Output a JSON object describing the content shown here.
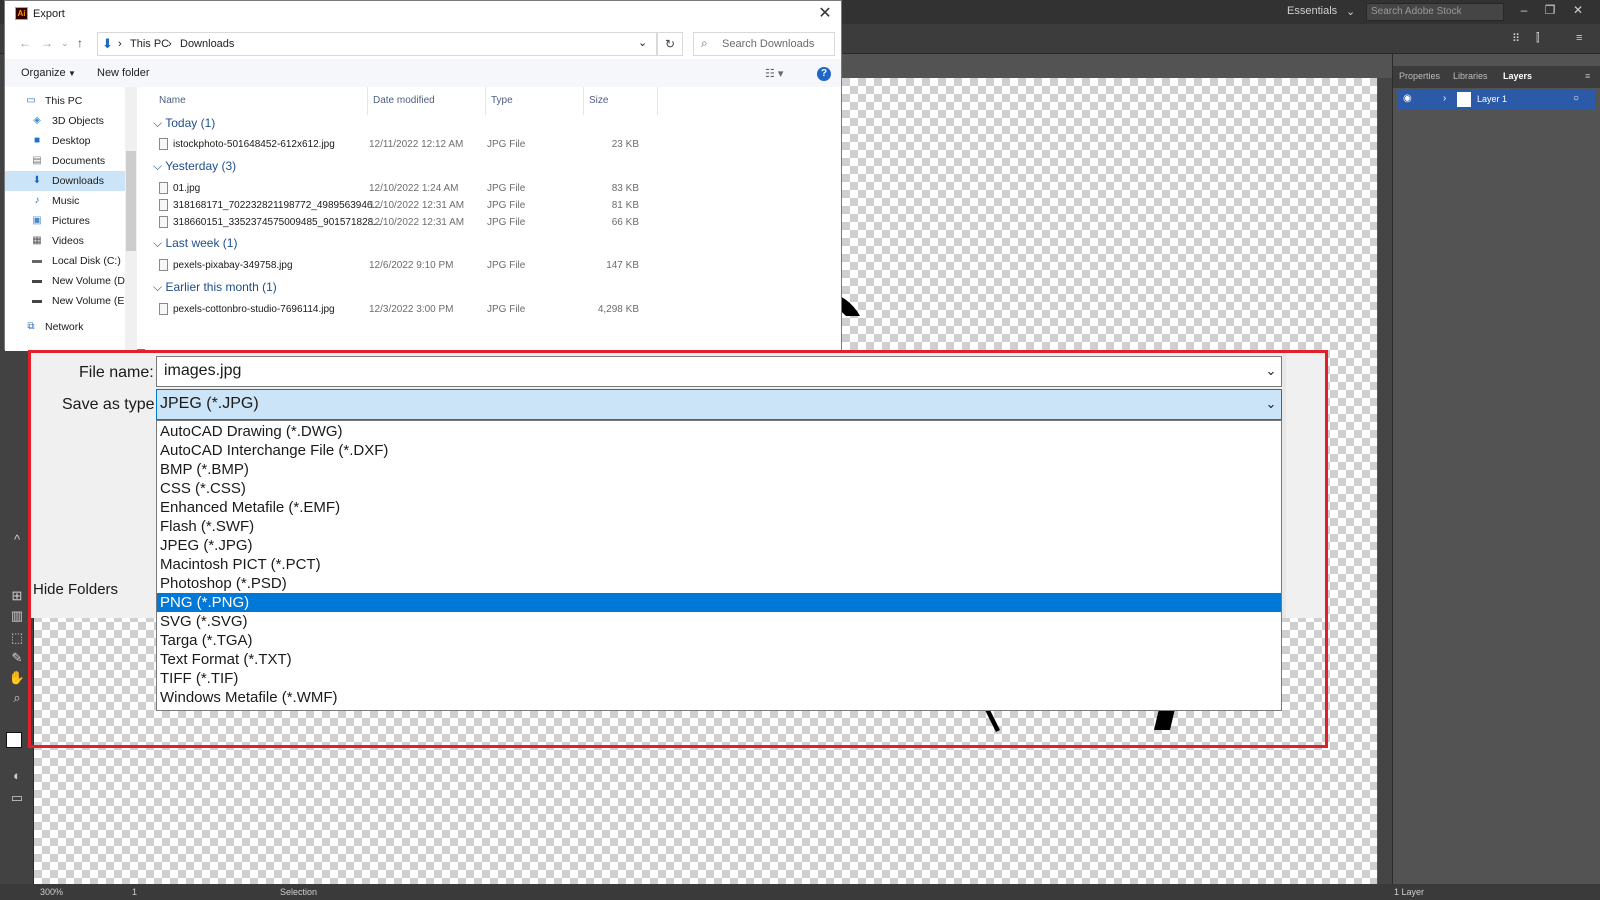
{
  "illustrator": {
    "workspace": "Essentials",
    "stock_search_placeholder": "Search Adobe Stock",
    "panel_tabs": [
      "Properties",
      "Libraries",
      "Layers"
    ],
    "active_tab": "Layers",
    "layer_name": "Layer 1",
    "status": {
      "zoom": "300%",
      "artboard": "1",
      "tool": "Selection",
      "layers_count": "1 Layer"
    }
  },
  "dialog": {
    "title": "Export",
    "logo": "Ai",
    "breadcrumb": [
      "This PC",
      "Downloads"
    ],
    "search_placeholder": "Search Downloads",
    "organize_label": "Organize",
    "new_folder_label": "New folder",
    "nav_items": [
      {
        "label": "This PC",
        "icon": "computer-icon"
      },
      {
        "label": "3D Objects",
        "icon": "cube-icon"
      },
      {
        "label": "Desktop",
        "icon": "desktop-icon"
      },
      {
        "label": "Documents",
        "icon": "document-icon"
      },
      {
        "label": "Downloads",
        "icon": "download-icon"
      },
      {
        "label": "Music",
        "icon": "music-icon"
      },
      {
        "label": "Pictures",
        "icon": "picture-icon"
      },
      {
        "label": "Videos",
        "icon": "video-icon"
      },
      {
        "label": "Local Disk (C:)",
        "icon": "disk-icon"
      },
      {
        "label": "New Volume (D:",
        "icon": "drive-icon"
      },
      {
        "label": "New Volume (E:)",
        "icon": "drive-icon"
      },
      {
        "label": "Network",
        "icon": "network-icon"
      }
    ],
    "columns": {
      "name": "Name",
      "date": "Date modified",
      "type": "Type",
      "size": "Size"
    },
    "groups": [
      {
        "label": "Today (1)",
        "files": [
          {
            "name": "istockphoto-501648452-612x612.jpg",
            "date": "12/11/2022 12:12 AM",
            "type": "JPG File",
            "size": "23 KB"
          }
        ]
      },
      {
        "label": "Yesterday (3)",
        "files": [
          {
            "name": "01.jpg",
            "date": "12/10/2022 1:24 AM",
            "type": "JPG File",
            "size": "83 KB"
          },
          {
            "name": "318168171_702232821198772_4989563946...",
            "date": "12/10/2022 12:31 AM",
            "type": "JPG File",
            "size": "81 KB"
          },
          {
            "name": "318660151_3352374575009485_901571828...",
            "date": "12/10/2022 12:31 AM",
            "type": "JPG File",
            "size": "66 KB"
          }
        ]
      },
      {
        "label": "Last week (1)",
        "files": [
          {
            "name": "pexels-pixabay-349758.jpg",
            "date": "12/6/2022 9:10 PM",
            "type": "JPG File",
            "size": "147 KB"
          }
        ]
      },
      {
        "label": "Earlier this month (1)",
        "files": [
          {
            "name": "pexels-cottonbro-studio-7696114.jpg",
            "date": "12/3/2022 3:00 PM",
            "type": "JPG File",
            "size": "4,298 KB"
          }
        ]
      }
    ],
    "file_name_label": "File name:",
    "file_name_value": "images.jpg",
    "save_type_label": "Save as type:",
    "save_type_value": "JPEG (*.JPG)",
    "save_type_options": [
      "AutoCAD Drawing (*.DWG)",
      "AutoCAD Interchange File (*.DXF)",
      "BMP (*.BMP)",
      "CSS (*.CSS)",
      "Enhanced Metafile (*.EMF)",
      "Flash (*.SWF)",
      "JPEG (*.JPG)",
      "Macintosh PICT (*.PCT)",
      "Photoshop (*.PSD)",
      "PNG (*.PNG)",
      "SVG (*.SVG)",
      "Targa (*.TGA)",
      "Text Format (*.TXT)",
      "TIFF (*.TIF)",
      "Windows Metafile (*.WMF)"
    ],
    "highlighted_option": "PNG (*.PNG)",
    "hide_folders_label": "Hide Folders"
  },
  "colors": {
    "highlight": "#0078d7",
    "annotation_border": "#e0202b",
    "ai_dark": "#323232"
  }
}
